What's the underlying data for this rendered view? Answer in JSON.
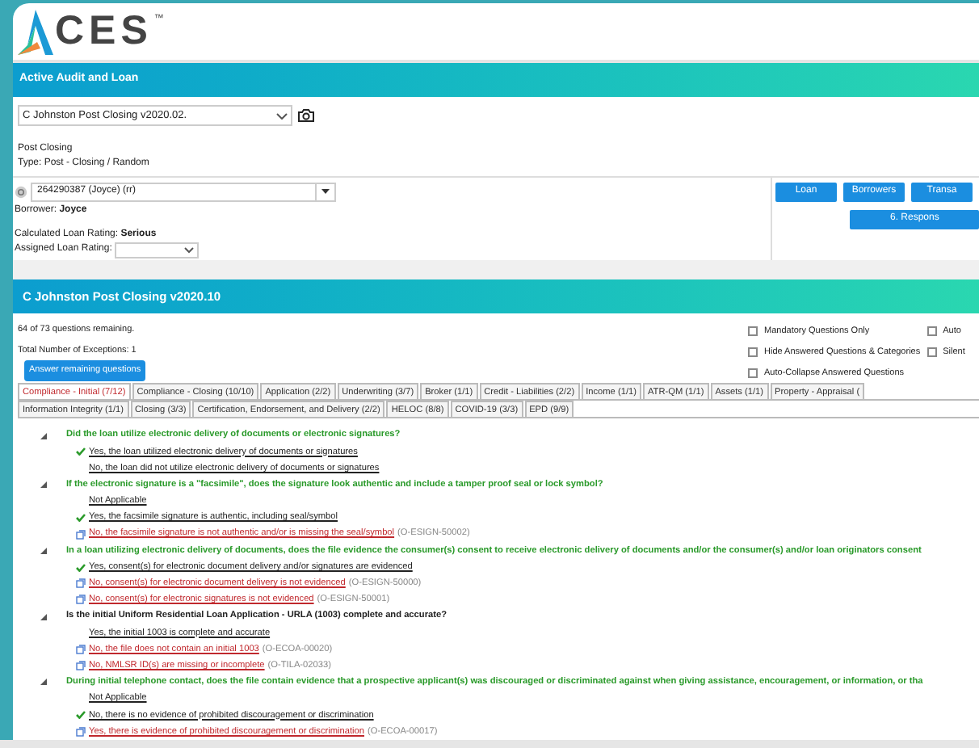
{
  "logo": {
    "text": "CES",
    "mark": "™"
  },
  "audit_panel": {
    "title": "Active Audit and Loan",
    "audit_select": "C Johnston Post Closing v2020.02.",
    "audit_name": "Post Closing",
    "audit_type": "Type: Post - Closing / Random"
  },
  "loan": {
    "select": "264290387 (Joyce) (rr)",
    "borrower": "Borrower: **Joyce**",
    "calculated_rating": "Calculated Loan Rating: **Serious**",
    "assigned_rating_label": "Assigned Loan Rating:"
  },
  "loan_buttons": [
    "Loan",
    "Borrowers",
    "Transa"
  ],
  "response_button": "6. Respons",
  "questionnaire": {
    "title": "C Johnston Post Closing v2020.10",
    "remaining": "64 of 73 questions remaining.",
    "exceptions": "Total Number of Exceptions: 1",
    "answer_button": "Answer remaining questions",
    "options": [
      {
        "label": "Mandatory Questions Only",
        "checked": false
      },
      {
        "label": "Hide Answered Questions & Categories",
        "checked": false
      },
      {
        "label": "Auto-Collapse Answered Questions",
        "checked": false
      },
      {
        "label": "Auto",
        "checked": false
      },
      {
        "label": "Silent",
        "checked": false
      }
    ],
    "tab_rows": [
      [
        {
          "label": "Compliance - Initial (7/12)",
          "selected": true
        },
        {
          "label": "Compliance - Closing (10/10)",
          "selected": false
        },
        {
          "label": "Application (2/2)",
          "selected": false
        },
        {
          "label": "Underwriting (3/7)",
          "selected": false
        },
        {
          "label": "Broker (1/1)",
          "selected": false
        },
        {
          "label": "Credit - Liabilities (2/2)",
          "selected": false
        },
        {
          "label": "Income (1/1)",
          "selected": false
        },
        {
          "label": "ATR-QM (1/1)",
          "selected": false
        },
        {
          "label": "Assets (1/1)",
          "selected": false
        },
        {
          "label": "Property - Appraisal (",
          "selected": false
        }
      ],
      [
        {
          "label": "Information Integrity (1/1)",
          "selected": false
        },
        {
          "label": "Closing (3/3)",
          "selected": false
        },
        {
          "label": "Certification, Endorsement, and Delivery (2/2)",
          "selected": false
        },
        {
          "label": "HELOC (8/8)",
          "selected": false
        },
        {
          "label": "COVID-19 (3/3)",
          "selected": false
        },
        {
          "label": "EPD (9/9)",
          "selected": false
        }
      ]
    ],
    "questions": [
      {
        "text": "Did the loan utilize electronic delivery of documents or electronic signatures?",
        "answers": [
          {
            "text": "Yes, the loan utilized electronic delivery of documents or signatures",
            "kind": "normal",
            "selected": true
          },
          {
            "text": "No, the loan did not utilize electronic delivery of documents or signatures",
            "kind": "normal",
            "selected": false
          }
        ]
      },
      {
        "text": "If the electronic signature is a \"facsimile\", does the signature look authentic and include a tamper proof seal or lock symbol?",
        "answers": [
          {
            "text": "Not Applicable",
            "kind": "normal",
            "selected": false
          },
          {
            "text": "Yes, the facsimile signature is authentic, including seal/symbol",
            "kind": "normal",
            "selected": true
          },
          {
            "text": "No, the facsimile signature is not authentic and/or is missing the seal/symbol",
            "kind": "exception",
            "selected": false,
            "code": "(O-ESIGN-50002)"
          }
        ]
      },
      {
        "text": "In a loan utilizing electronic delivery of documents, does the file evidence the consumer(s) consent to receive electronic delivery of documents and/or the consumer(s) and/or loan originators consent",
        "answers": [
          {
            "text": "Yes, consent(s) for electronic document delivery and/or signatures are evidenced",
            "kind": "normal",
            "selected": true
          },
          {
            "text": "No, consent(s) for electronic document delivery is not evidenced",
            "kind": "exception",
            "selected": false,
            "code": "(O-ESIGN-50000)"
          },
          {
            "text": "No, consent(s) for electronic signatures is not evidenced",
            "kind": "exception",
            "selected": false,
            "code": "(O-ESIGN-50001)"
          }
        ]
      },
      {
        "text": "Is the initial Uniform Residential Loan Application - URLA (1003) complete and accurate?",
        "answers": [
          {
            "text": "Yes, the initial 1003 is complete and accurate",
            "kind": "normal",
            "selected": false
          },
          {
            "text": "No, the file does not contain an initial 1003",
            "kind": "exception",
            "selected": false,
            "code": "(O-ECOA-00020)"
          },
          {
            "text": "No, NMLSR ID(s) are missing or incomplete",
            "kind": "exception",
            "selected": false,
            "code": "(O-TILA-02033)"
          }
        ]
      },
      {
        "text": "During initial telephone contact, does the file contain evidence that a prospective applicant(s) was discouraged or discriminated against when giving assistance, encouragement, or information, or tha",
        "answers": [
          {
            "text": "Not Applicable",
            "kind": "normal",
            "selected": false
          },
          {
            "text": "No, there is no evidence of prohibited discouragement or discrimination",
            "kind": "normal",
            "selected": true
          },
          {
            "text": "Yes, there is evidence of prohibited discouragement or discrimination",
            "kind": "exception",
            "selected": false,
            "code": "(O-ECOA-00017)"
          }
        ]
      }
    ]
  }
}
